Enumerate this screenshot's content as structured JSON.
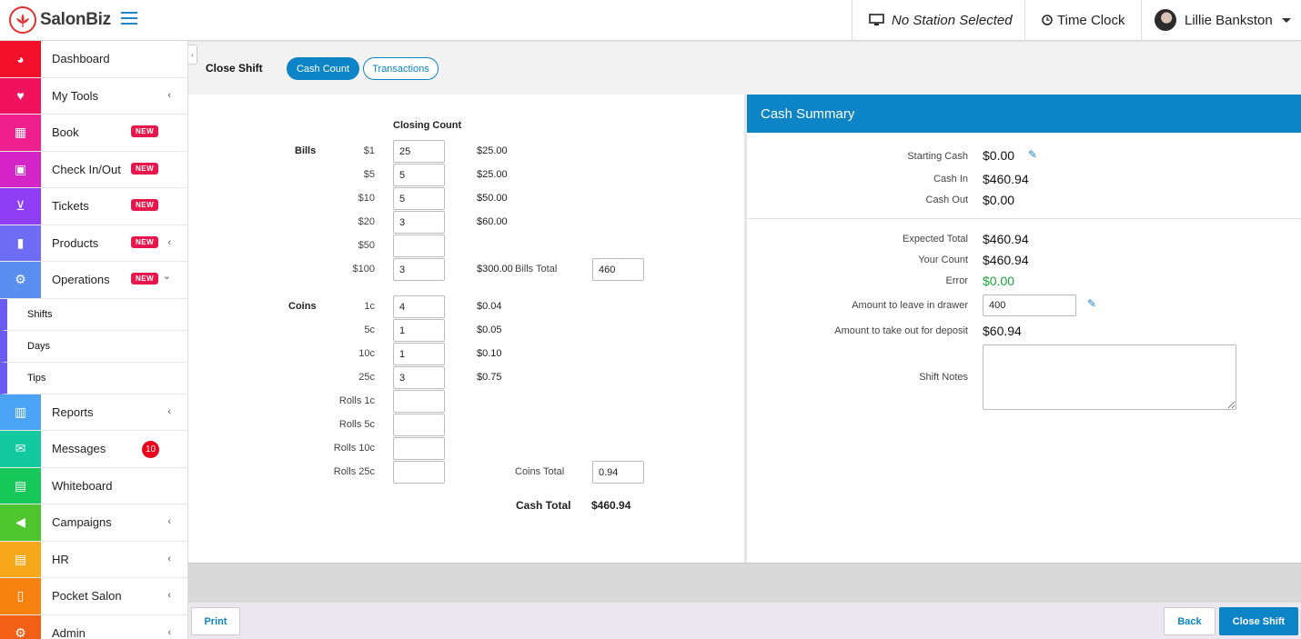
{
  "header": {
    "logo_text": "SalonBiz",
    "station": "No Station Selected",
    "time_clock": "Time Clock",
    "user_name": "Lillie Bankston"
  },
  "sidebar": {
    "items": [
      {
        "label": "Dashboard",
        "color": "#f4102a",
        "icon": "dashboard-icon",
        "glyph": "◕"
      },
      {
        "label": "My Tools",
        "color": "#f0125c",
        "icon": "heart-pulse-icon",
        "glyph": "♥",
        "chevron": "‹"
      },
      {
        "label": "Book",
        "color": "#ef1f8e",
        "icon": "calendar-icon",
        "glyph": "▦",
        "badge": "NEW"
      },
      {
        "label": "Check In/Out",
        "color": "#d424c8",
        "icon": "calendar-check-icon",
        "glyph": "▣",
        "badge": "NEW"
      },
      {
        "label": "Tickets",
        "color": "#8f3ef6",
        "icon": "cart-icon",
        "glyph": "⊻",
        "badge": "NEW"
      },
      {
        "label": "Products",
        "color": "#6f6cf5",
        "icon": "bottles-icon",
        "glyph": "▮",
        "badge": "NEW",
        "chevron": "‹"
      },
      {
        "label": "Operations",
        "color": "#5a8ff0",
        "icon": "cogs-icon",
        "glyph": "⚙",
        "badge": "NEW",
        "chevron": "⌄"
      }
    ],
    "sub_items": [
      "Shifts",
      "Days",
      "Tips"
    ],
    "items_after": [
      {
        "label": "Reports",
        "color": "#4aa3f5",
        "icon": "bar-chart-icon",
        "glyph": "▥",
        "chevron": "‹"
      },
      {
        "label": "Messages",
        "color": "#12c9a0",
        "icon": "envelope-icon",
        "glyph": "✉",
        "count": "10"
      },
      {
        "label": "Whiteboard",
        "color": "#16c75a",
        "icon": "whiteboard-icon",
        "glyph": "▤"
      },
      {
        "label": "Campaigns",
        "color": "#4ec52e",
        "icon": "megaphone-icon",
        "glyph": "◀",
        "chevron": "‹"
      },
      {
        "label": "HR",
        "color": "#f7a81a",
        "icon": "document-icon",
        "glyph": "▤",
        "chevron": "‹"
      },
      {
        "label": "Pocket Salon",
        "color": "#f7820f",
        "icon": "mobile-icon",
        "glyph": "▯",
        "chevron": "‹"
      },
      {
        "label": "Admin",
        "color": "#f45f16",
        "icon": "gear-icon",
        "glyph": "⚙",
        "chevron": "‹"
      }
    ]
  },
  "page": {
    "title": "Close Shift",
    "tabs": [
      "Cash Count",
      "Transactions"
    ]
  },
  "count": {
    "column_header": "Closing Count",
    "bills_label": "Bills",
    "coins_label": "Coins",
    "bills": [
      {
        "denom": "$1",
        "value": "25",
        "amount": "$25.00"
      },
      {
        "denom": "$5",
        "value": "5",
        "amount": "$25.00"
      },
      {
        "denom": "$10",
        "value": "5",
        "amount": "$50.00"
      },
      {
        "denom": "$20",
        "value": "3",
        "amount": "$60.00"
      },
      {
        "denom": "$50",
        "value": "",
        "amount": ""
      },
      {
        "denom": "$100",
        "value": "3",
        "amount": "$300.00"
      }
    ],
    "bills_total_label": "Bills Total",
    "bills_total": "460",
    "coins": [
      {
        "denom": "1c",
        "value": "4",
        "amount": "$0.04"
      },
      {
        "denom": "5c",
        "value": "1",
        "amount": "$0.05"
      },
      {
        "denom": "10c",
        "value": "1",
        "amount": "$0.10"
      },
      {
        "denom": "25c",
        "value": "3",
        "amount": "$0.75"
      },
      {
        "denom": "Rolls 1c",
        "value": "",
        "amount": ""
      },
      {
        "denom": "Rolls 5c",
        "value": "",
        "amount": ""
      },
      {
        "denom": "Rolls 10c",
        "value": "",
        "amount": ""
      },
      {
        "denom": "Rolls 25c",
        "value": "",
        "amount": ""
      }
    ],
    "coins_total_label": "Coins Total",
    "coins_total": "0.94",
    "cash_total_label": "Cash Total",
    "cash_total": "$460.94"
  },
  "summary": {
    "title": "Cash Summary",
    "starting_cash_label": "Starting Cash",
    "starting_cash": "$0.00",
    "cash_in_label": "Cash In",
    "cash_in": "$460.94",
    "cash_out_label": "Cash Out",
    "cash_out": "$0.00",
    "expected_total_label": "Expected Total",
    "expected_total": "$460.94",
    "your_count_label": "Your Count",
    "your_count": "$460.94",
    "error_label": "Error",
    "error": "$0.00",
    "error_color": "#1aa33a",
    "leave_label": "Amount to leave in drawer",
    "leave_value": "400",
    "deposit_label": "Amount to take out for deposit",
    "deposit": "$60.94",
    "notes_label": "Shift Notes",
    "notes_value": ""
  },
  "footer": {
    "print": "Print",
    "back": "Back",
    "close_shift": "Close Shift"
  },
  "colors": {
    "accent": "#0d84c5"
  }
}
